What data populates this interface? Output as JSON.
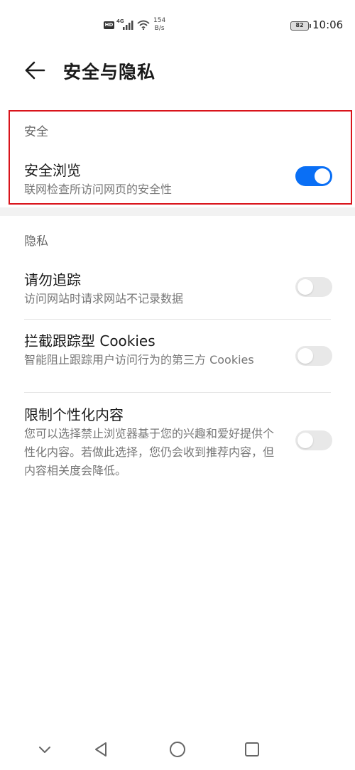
{
  "status_bar": {
    "hd": "HD",
    "network": "4G",
    "speed_value": "154",
    "speed_unit": "B/s",
    "battery": "82",
    "time": "10:06"
  },
  "header": {
    "back_icon": "arrow-left-icon",
    "title": "安全与隐私"
  },
  "security": {
    "label": "安全",
    "items": [
      {
        "title": "安全浏览",
        "desc": "联网检查所访问网页的安全性",
        "enabled": true
      }
    ]
  },
  "privacy": {
    "label": "隐私",
    "items": [
      {
        "title": "请勿追踪",
        "desc": "访问网站时请求网站不记录数据",
        "enabled": false
      },
      {
        "title": "拦截跟踪型 Cookies",
        "desc": "智能阻止跟踪用户访问行为的第三方 Cookies",
        "enabled": false
      },
      {
        "title": "限制个性化内容",
        "desc": "您可以选择禁止浏览器基于您的兴趣和爱好提供个性化内容。若做此选择，您仍会收到推荐内容，但内容相关度会降低。",
        "enabled": false
      }
    ]
  },
  "colors": {
    "accent": "#0a6ff5",
    "highlight_border": "#d9141b"
  },
  "nav_bar": {
    "icons": [
      "chevron-down-icon",
      "back-triangle-icon",
      "home-circle-icon",
      "recents-square-icon"
    ]
  }
}
